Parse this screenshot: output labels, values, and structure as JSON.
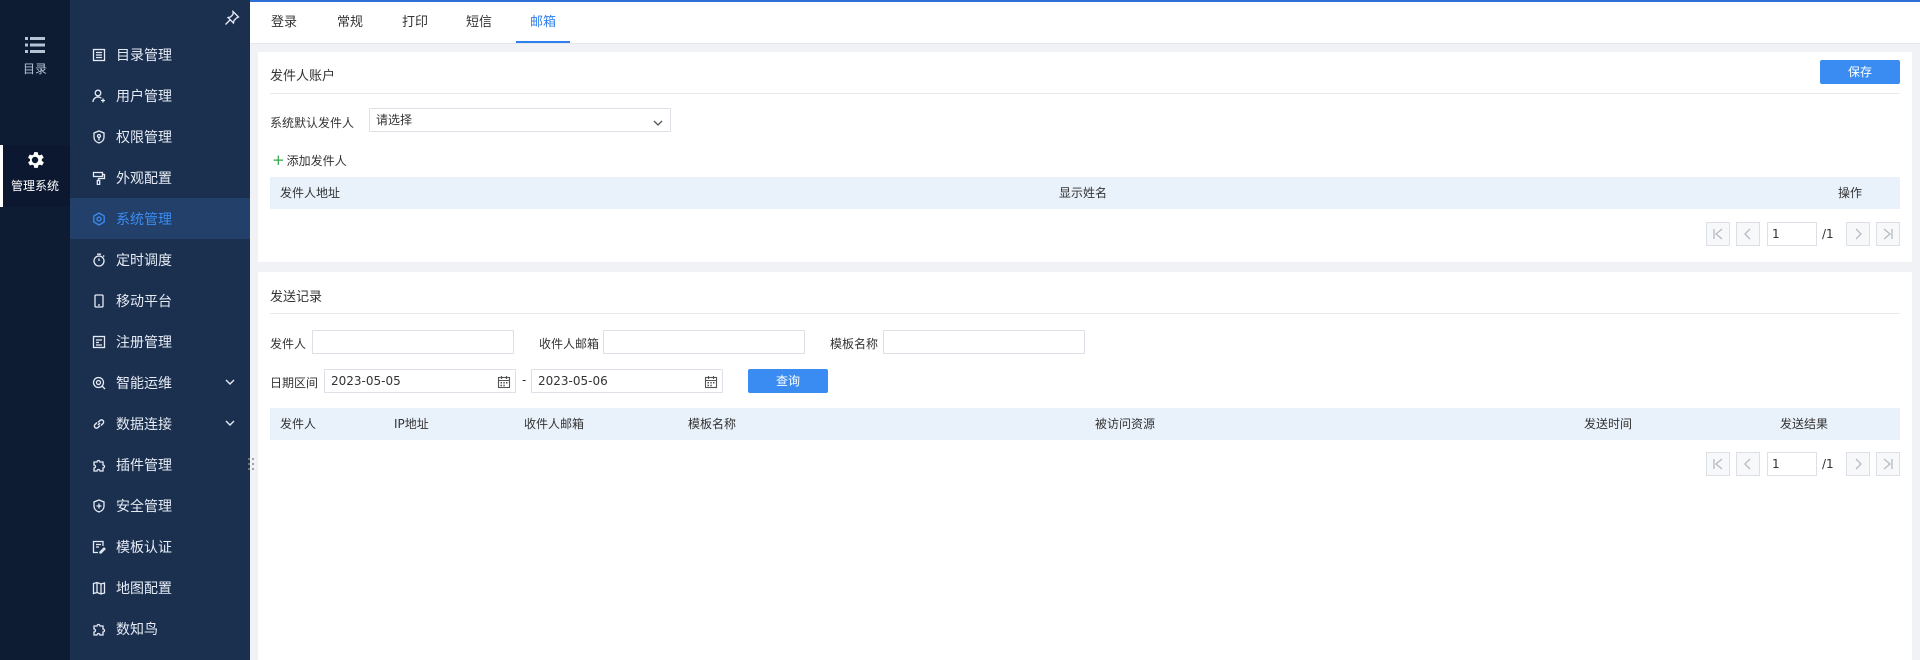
{
  "rail": {
    "items": [
      {
        "label": "目录",
        "icon": "list-icon"
      },
      {
        "label": "管理系统",
        "icon": "gear-icon",
        "active": true
      }
    ]
  },
  "sidebar": {
    "items": [
      {
        "label": "目录管理",
        "icon": "book-icon"
      },
      {
        "label": "用户管理",
        "icon": "user-icon"
      },
      {
        "label": "权限管理",
        "icon": "shield-key-icon"
      },
      {
        "label": "外观配置",
        "icon": "paint-roller-icon"
      },
      {
        "label": "系统管理",
        "icon": "gear-icon",
        "active": true
      },
      {
        "label": "定时调度",
        "icon": "stopwatch-icon"
      },
      {
        "label": "移动平台",
        "icon": "phone-icon"
      },
      {
        "label": "注册管理",
        "icon": "register-icon"
      },
      {
        "label": "智能运维",
        "icon": "ops-icon",
        "expandable": true
      },
      {
        "label": "数据连接",
        "icon": "link-icon",
        "expandable": true
      },
      {
        "label": "插件管理",
        "icon": "puzzle-icon"
      },
      {
        "label": "安全管理",
        "icon": "shield-plus-icon"
      },
      {
        "label": "模板认证",
        "icon": "template-icon"
      },
      {
        "label": "地图配置",
        "icon": "map-icon"
      },
      {
        "label": "数知鸟",
        "icon": "bird-icon"
      }
    ]
  },
  "tabs": [
    "登录",
    "常规",
    "打印",
    "短信",
    "邮箱"
  ],
  "active_tab": "邮箱",
  "sender_panel": {
    "title": "发件人账户",
    "save_label": "保存",
    "default_sender_label": "系统默认发件人",
    "default_sender_placeholder": "请选择",
    "add_sender_label": "添加发件人",
    "columns": [
      "发件人地址",
      "显示姓名",
      "操作"
    ],
    "pager": {
      "page": "1",
      "total": "/1"
    }
  },
  "record_panel": {
    "title": "发送记录",
    "sender_label": "发件人",
    "sender_value": "",
    "recipient_label": "收件人邮箱",
    "recipient_value": "",
    "template_label": "模板名称",
    "template_value": "",
    "date_label": "日期区间",
    "date_from": "2023-05-05",
    "date_sep": "-",
    "date_to": "2023-05-06",
    "query_label": "查询",
    "columns": [
      "发件人",
      "IP地址",
      "收件人邮箱",
      "模板名称",
      "被访问资源",
      "发送时间",
      "发送结果"
    ],
    "pager": {
      "page": "1",
      "total": "/1"
    }
  },
  "colors": {
    "accent": "#3b8cf2",
    "sidebar_bg": "#1b2f4f",
    "rail_bg": "#0d1b33",
    "table_head_bg": "#e9f1fb"
  }
}
